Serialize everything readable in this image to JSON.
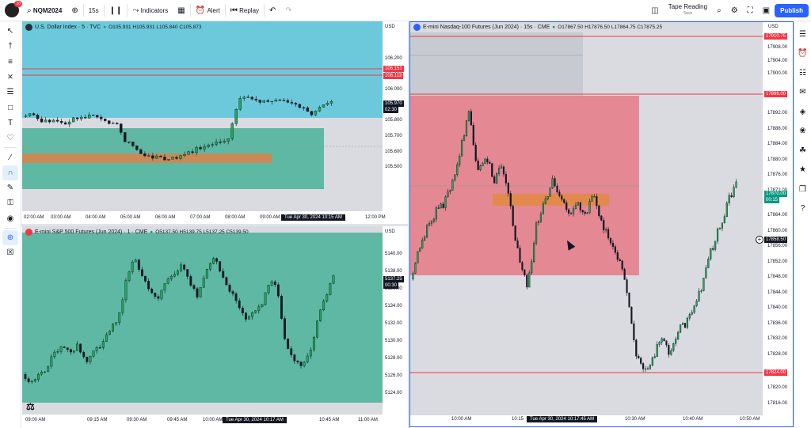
{
  "topbar": {
    "avatar_badge": "10",
    "symbol": "NQM2024",
    "interval": "15s",
    "indicators": "Indicators",
    "alert": "Alert",
    "replay": "Replay",
    "layout_name": "Tape Reading",
    "layout_status": "Save",
    "publish": "Publish"
  },
  "left_tools": [
    "cursor-icon",
    "crosshair-line-icon",
    "trend-line-icon",
    "fib-icon",
    "pattern-icon",
    "measure-icon",
    "text-icon",
    "heart-icon",
    "ruler-icon",
    "magnet-icon",
    "lock-draw-icon",
    "lock-icon",
    "eye-icon",
    "globe-icon",
    "trash-icon"
  ],
  "right_tools": [
    "watchlist-icon",
    "alerts-clock-icon",
    "object-tree-icon",
    "chat-icon",
    "layers-icon",
    "ideas-icon",
    "pine-icon",
    "hotlist-icon",
    "comments-icon",
    "help-icon"
  ],
  "pane_dxy": {
    "title": "U.S. Dollar Index · 5 · TVC",
    "ohlc": "O105.931 H105.931 L105.840 C105.873",
    "currency": "USD",
    "price_ticks": [
      "106.200",
      "106.100",
      "106.000",
      "105.900",
      "105.800",
      "105.700",
      "105.600",
      "105.500"
    ],
    "price_labels": [
      {
        "text": "106.151",
        "color": "#f23645"
      },
      {
        "text": "106.113",
        "color": "#f23645"
      },
      {
        "text": "105.970",
        "color": "#131722"
      },
      {
        "text": "02:30",
        "color": "#131722"
      }
    ],
    "time_ticks": [
      "02:00 AM",
      "03:00 AM",
      "04:00 AM",
      "05:00 AM",
      "06:00 AM",
      "07:00 AM",
      "08:00 AM",
      "09:00 AM",
      "12:00 PM"
    ],
    "crosshair_time": "Tue Apr 30, 2024 10:15 AM"
  },
  "pane_es": {
    "title": "E-mini S&P 500 Futures (Jun 2024) · 1 · CME",
    "ohlc": "O5137.50 H5139.75 L5137.25 C5139.50",
    "currency": "USD",
    "price_ticks": [
      "5140.00",
      "5138.00",
      "5136.00",
      "5134.00",
      "5132.00",
      "5130.00",
      "5128.00",
      "5126.00",
      "5124.00"
    ],
    "price_labels": [
      {
        "text": "5137.25",
        "color": "#131722"
      },
      {
        "text": "00:30",
        "color": "#131722"
      }
    ],
    "time_ticks": [
      "09:00 AM",
      "09:15 AM",
      "09:30 AM",
      "09:45 AM",
      "10:00 AM",
      "10:30 AM",
      "10:45 AM",
      "11:00 AM"
    ],
    "crosshair_time": "Tue Apr 30, 2024 10:17 AM"
  },
  "pane_nq": {
    "title": "E-mini Nasdaq-100 Futures (Jun 2024) · 15s · CME",
    "ohlc": "O17867.50 H17876.50 L17864.75 C17875.25",
    "currency": "USD",
    "price_ticks": [
      "17908.00",
      "17904.00",
      "17900.00",
      "17892.00",
      "17888.00",
      "17884.00",
      "17880.00",
      "17876.00",
      "17872.00",
      "17864.00",
      "17860.00",
      "17856.00",
      "17852.00",
      "17848.00",
      "17844.00",
      "17840.00",
      "17836.00",
      "17832.00",
      "17828.00",
      "17820.00",
      "17816.00"
    ],
    "price_labels": [
      {
        "text": "17910.75",
        "color": "#f23645"
      },
      {
        "text": "17896.00",
        "color": "#f23645"
      },
      {
        "text": "17870.00",
        "color": "#089981"
      },
      {
        "text": "00:15",
        "color": "#089981"
      },
      {
        "text": "17858.50",
        "color": "#131722"
      },
      {
        "text": "17824.00",
        "color": "#f23645"
      }
    ],
    "time_ticks": [
      "10:00 AM",
      "10:15",
      "10:30 AM",
      "10:40 AM",
      "10:50 AM"
    ],
    "crosshair_time": "Tue Apr 30, 2024 10:17:45 AM"
  }
}
